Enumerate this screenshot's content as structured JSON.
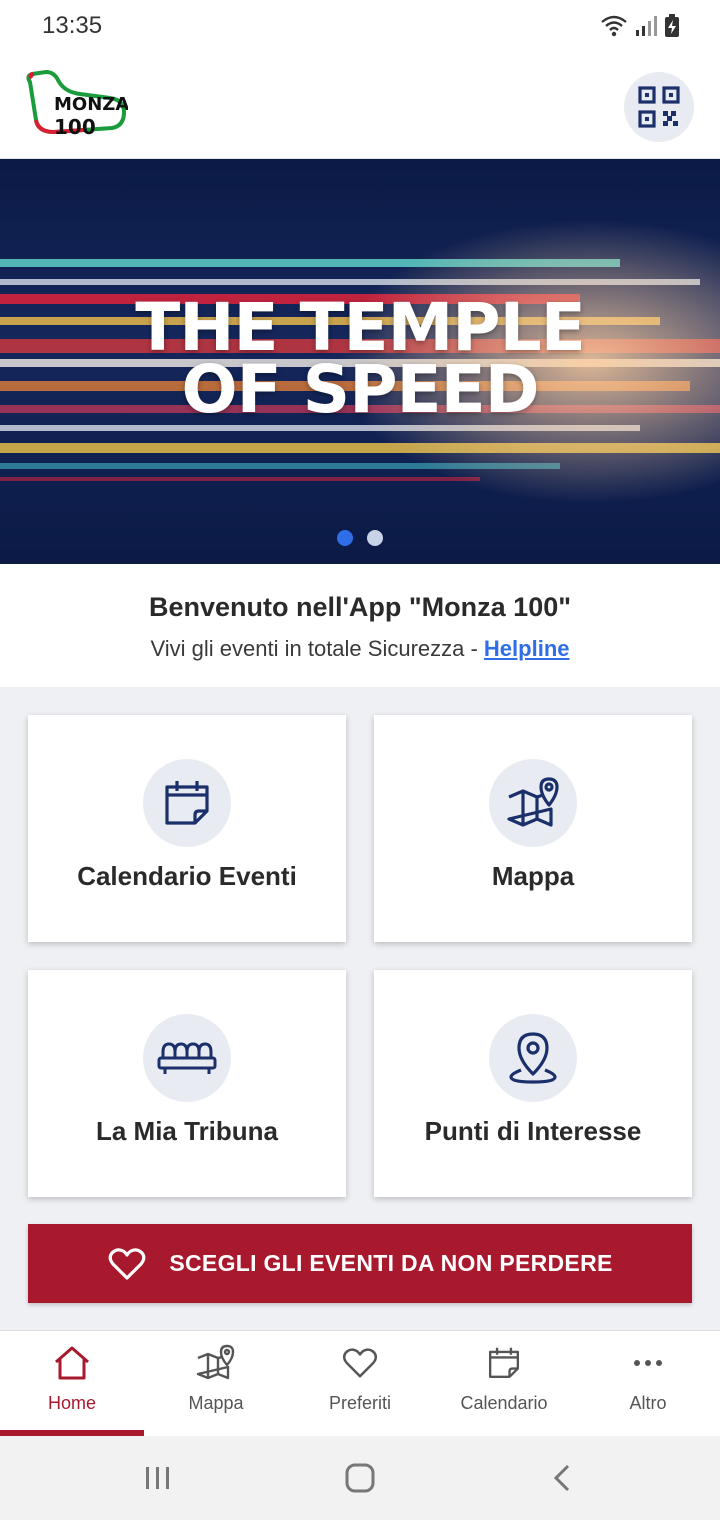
{
  "status_bar": {
    "time": "13:35"
  },
  "header": {
    "logo_text": "MONZA",
    "logo_number": "100"
  },
  "hero": {
    "title_line1": "THE TEMPLE",
    "title_line2": "OF SPEED",
    "slide_count": 2,
    "active_slide": 1
  },
  "welcome": {
    "title": "Benvenuto nell'App \"Monza 100\"",
    "subtitle": "Vivi gli eventi in totale Sicurezza - ",
    "helpline": "Helpline"
  },
  "tiles": [
    {
      "label": "Calendario Eventi",
      "icon": "calendar-icon"
    },
    {
      "label": "Mappa",
      "icon": "map-pin-icon"
    },
    {
      "label": "La Mia Tribuna",
      "icon": "grandstand-icon"
    },
    {
      "label": "Punti di Interesse",
      "icon": "location-pin-icon"
    }
  ],
  "cta": {
    "label": "SCEGLI GLI EVENTI DA NON PERDERE",
    "icon": "heart-icon"
  },
  "tabbar": {
    "items": [
      {
        "label": "Home",
        "icon": "home-icon",
        "active": true
      },
      {
        "label": "Mappa",
        "icon": "map-icon",
        "active": false
      },
      {
        "label": "Preferiti",
        "icon": "heart-icon",
        "active": false
      },
      {
        "label": "Calendario",
        "icon": "calendar-icon",
        "active": false
      },
      {
        "label": "Altro",
        "icon": "more-icon",
        "active": false
      }
    ]
  },
  "colors": {
    "accent": "#a8192e",
    "link": "#2f6ee6",
    "icon": "#1b2f6b",
    "hero_bg": "#0c1d4c"
  }
}
